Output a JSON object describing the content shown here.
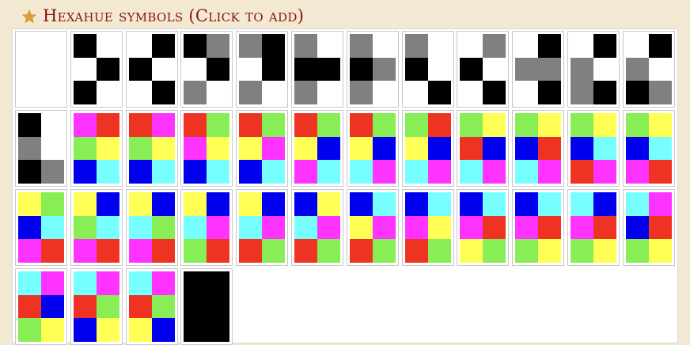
{
  "header": {
    "title": "Hexahue symbols (Click to add)",
    "icon": "star-icon",
    "icon_color": "#e0a030",
    "title_color": "#8a1414"
  },
  "colors": {
    "K": "#000000",
    "G": "#808080",
    "W": "#ffffff",
    "M": "#ff33ff",
    "R": "#ee3322",
    "L": "#88ee55",
    "Y": "#ffff55",
    "B": "#0000ee",
    "C": "#77ffff"
  },
  "symbols": [
    {
      "name": "space",
      "cells": [
        "W",
        "W",
        "W",
        "W",
        "W",
        "W"
      ]
    },
    {
      "name": "period",
      "cells": [
        "K",
        "W",
        "W",
        "K",
        "K",
        "W"
      ]
    },
    {
      "name": "comma",
      "cells": [
        "W",
        "K",
        "K",
        "W",
        "W",
        "K"
      ]
    },
    {
      "name": "digit-0",
      "cells": [
        "K",
        "G",
        "W",
        "K",
        "G",
        "W"
      ]
    },
    {
      "name": "digit-1",
      "cells": [
        "G",
        "K",
        "W",
        "K",
        "G",
        "W"
      ]
    },
    {
      "name": "digit-2",
      "cells": [
        "G",
        "W",
        "K",
        "K",
        "G",
        "W"
      ]
    },
    {
      "name": "digit-3",
      "cells": [
        "G",
        "W",
        "K",
        "G",
        "G",
        "W"
      ]
    },
    {
      "name": "digit-4",
      "cells": [
        "G",
        "W",
        "K",
        "W",
        "W",
        "K"
      ]
    },
    {
      "name": "digit-5",
      "cells": [
        "W",
        "G",
        "K",
        "W",
        "W",
        "K"
      ]
    },
    {
      "name": "digit-6",
      "cells": [
        "W",
        "K",
        "G",
        "G",
        "W",
        "K"
      ]
    },
    {
      "name": "digit-7",
      "cells": [
        "W",
        "K",
        "G",
        "W",
        "G",
        "K"
      ]
    },
    {
      "name": "digit-8",
      "cells": [
        "W",
        "K",
        "G",
        "W",
        "K",
        "G"
      ]
    },
    {
      "name": "digit-9",
      "cells": [
        "K",
        "W",
        "G",
        "W",
        "K",
        "G"
      ]
    },
    {
      "name": "letter-a",
      "cells": [
        "M",
        "R",
        "L",
        "Y",
        "B",
        "C"
      ]
    },
    {
      "name": "letter-b",
      "cells": [
        "R",
        "M",
        "L",
        "Y",
        "B",
        "C"
      ]
    },
    {
      "name": "letter-c",
      "cells": [
        "R",
        "L",
        "M",
        "Y",
        "B",
        "C"
      ]
    },
    {
      "name": "letter-d",
      "cells": [
        "R",
        "L",
        "Y",
        "M",
        "B",
        "C"
      ]
    },
    {
      "name": "letter-e",
      "cells": [
        "R",
        "L",
        "Y",
        "B",
        "M",
        "C"
      ]
    },
    {
      "name": "letter-f",
      "cells": [
        "R",
        "L",
        "Y",
        "B",
        "C",
        "M"
      ]
    },
    {
      "name": "letter-g",
      "cells": [
        "L",
        "R",
        "Y",
        "B",
        "C",
        "M"
      ]
    },
    {
      "name": "letter-h",
      "cells": [
        "L",
        "Y",
        "R",
        "B",
        "C",
        "M"
      ]
    },
    {
      "name": "letter-i",
      "cells": [
        "L",
        "Y",
        "B",
        "R",
        "C",
        "M"
      ]
    },
    {
      "name": "letter-j",
      "cells": [
        "L",
        "Y",
        "B",
        "C",
        "R",
        "M"
      ]
    },
    {
      "name": "letter-k",
      "cells": [
        "L",
        "Y",
        "B",
        "C",
        "M",
        "R"
      ]
    },
    {
      "name": "letter-l",
      "cells": [
        "Y",
        "L",
        "B",
        "C",
        "M",
        "R"
      ]
    },
    {
      "name": "letter-m",
      "cells": [
        "Y",
        "B",
        "L",
        "C",
        "M",
        "R"
      ]
    },
    {
      "name": "letter-n",
      "cells": [
        "Y",
        "B",
        "C",
        "L",
        "M",
        "R"
      ]
    },
    {
      "name": "letter-o",
      "cells": [
        "Y",
        "B",
        "C",
        "M",
        "L",
        "R"
      ]
    },
    {
      "name": "letter-p",
      "cells": [
        "Y",
        "B",
        "C",
        "M",
        "R",
        "L"
      ]
    },
    {
      "name": "letter-q",
      "cells": [
        "B",
        "Y",
        "C",
        "M",
        "R",
        "L"
      ]
    },
    {
      "name": "letter-r",
      "cells": [
        "B",
        "C",
        "Y",
        "M",
        "R",
        "L"
      ]
    },
    {
      "name": "letter-s",
      "cells": [
        "B",
        "C",
        "M",
        "Y",
        "R",
        "L"
      ]
    },
    {
      "name": "letter-t",
      "cells": [
        "B",
        "C",
        "M",
        "R",
        "Y",
        "L"
      ]
    },
    {
      "name": "letter-u",
      "cells": [
        "B",
        "C",
        "M",
        "R",
        "L",
        "Y"
      ]
    },
    {
      "name": "letter-v",
      "cells": [
        "C",
        "B",
        "M",
        "R",
        "L",
        "Y"
      ]
    },
    {
      "name": "letter-w",
      "cells": [
        "C",
        "M",
        "B",
        "R",
        "L",
        "Y"
      ]
    },
    {
      "name": "letter-x",
      "cells": [
        "C",
        "M",
        "R",
        "B",
        "L",
        "Y"
      ]
    },
    {
      "name": "letter-y",
      "cells": [
        "C",
        "M",
        "R",
        "L",
        "B",
        "Y"
      ]
    },
    {
      "name": "letter-z",
      "cells": [
        "C",
        "M",
        "R",
        "L",
        "Y",
        "B"
      ]
    },
    {
      "name": "full-stop-block",
      "cells": [
        "K",
        "K",
        "K",
        "K",
        "K",
        "K"
      ]
    }
  ]
}
